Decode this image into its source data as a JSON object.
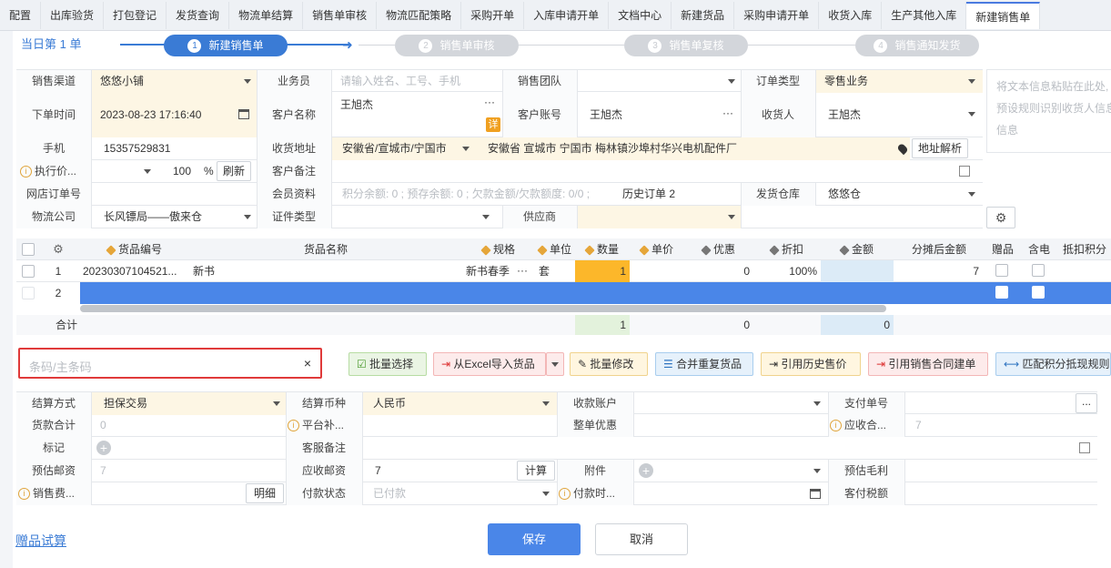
{
  "tabs": [
    "配置",
    "出库验货",
    "打包登记",
    "发货查询",
    "物流单结算",
    "销售单审核",
    "物流匹配策略",
    "采购开单",
    "入库申请开单",
    "文档中心",
    "新建货品",
    "采购申请开单",
    "收货入库",
    "生产其他入库",
    "新建销售单"
  ],
  "steps": {
    "day_label": "当日第 1 单",
    "items": [
      "新建销售单",
      "销售单审核",
      "销售单复核",
      "销售通知发货"
    ],
    "nums": [
      "1",
      "2",
      "3",
      "4"
    ]
  },
  "form": {
    "channel_label": "销售渠道",
    "channel_value": "悠悠小铺",
    "clerk_label": "业务员",
    "clerk_placeholder": "请输入姓名、工号、手机",
    "team_label": "销售团队",
    "order_type_label": "订单类型",
    "order_type_value": "零售业务",
    "paste_placeholder_1": "将文本信息粘贴在此处,",
    "paste_placeholder_2": "预设规则识别收货人信息",
    "paste_placeholder_3": "信息",
    "time_label": "下单时间",
    "time_value": "2023-08-23 17:16:40",
    "customer_label": "客户名称",
    "customer_value": "王旭杰",
    "detail_badge": "详",
    "account_label": "客户账号",
    "account_value": "王旭杰",
    "receiver_label": "收货人",
    "receiver_value": "王旭杰",
    "phone_label": "手机",
    "phone_value": "15357529831",
    "address_label": "收货地址",
    "region_value": "安徽省/宣城市/宁国市",
    "address_value": "安徽省 宣城市 宁国市  梅林镇沙埠村华兴电机配件厂",
    "parse_btn": "地址解析",
    "price_label": "执行价...",
    "price_pct": "100",
    "pct_sign": "%",
    "refresh_btn": "刷新",
    "remark_label": "客户备注",
    "shop_order_label": "网店订单号",
    "member_label": "会员资料",
    "member_value": "积分余额: 0 ; 预存余额: 0 ; 欠款金额/欠款额度: 0/0 ;",
    "history_label": "历史订单 2",
    "warehouse_label": "发货仓库",
    "warehouse_value": "悠悠仓",
    "logistics_label": "物流公司",
    "logistics_value": "长风镖局——傲来仓",
    "id_type_label": "证件类型",
    "supplier_label": "供应商"
  },
  "grid": {
    "headers": [
      "货品编号",
      "货品名称",
      "规格",
      "单位",
      "数量",
      "单价",
      "优惠",
      "折扣",
      "金额",
      "分摊后金额",
      "赠品",
      "含电",
      "抵扣积分"
    ],
    "rows": [
      {
        "idx": "1",
        "code": "20230307104521...",
        "name": "新书",
        "spec": "新书春季",
        "unit": "套",
        "qty": "1",
        "price": "",
        "discount_amt": "0",
        "discount_rate": "100%",
        "amount": "",
        "alloc": "7"
      },
      {
        "idx": "2"
      }
    ],
    "total_label": "合计",
    "total_qty": "1",
    "total_disc": "0",
    "total_amt": "0"
  },
  "barcode_placeholder": "条码/主条码",
  "toolbar": [
    "批量选择",
    "从Excel导入货品",
    "批量修改",
    "合并重复货品",
    "引用历史售价",
    "引用销售合同建单",
    "匹配积分抵现规则"
  ],
  "settle": {
    "method_label": "结算方式",
    "method_value": "担保交易",
    "currency_label": "结算币种",
    "currency_value": "人民币",
    "account_label": "收款账户",
    "payno_label": "支付单号",
    "goods_total_label": "货款合计",
    "goods_total_value": "0",
    "platform_label": "平台补...",
    "whole_disc_label": "整单优惠",
    "receivable_label": "应收合...",
    "receivable_value": "7",
    "mark_label": "标记",
    "service_remark_label": "客服备注",
    "est_post_label": "预估邮资",
    "est_post_value": "7",
    "recv_post_label": "应收邮资",
    "recv_post_value": "7",
    "calc_btn": "计算",
    "attach_label": "附件",
    "gross_label": "预估毛利",
    "sales_fee_label": "销售费...",
    "detail_btn": "明细",
    "pay_status_label": "付款状态",
    "pay_status_value": "已付款",
    "pay_time_label": "付款时...",
    "tax_label": "客付税额"
  },
  "footer": {
    "gift_link": "赠品试算",
    "save": "保存",
    "cancel": "取消"
  }
}
